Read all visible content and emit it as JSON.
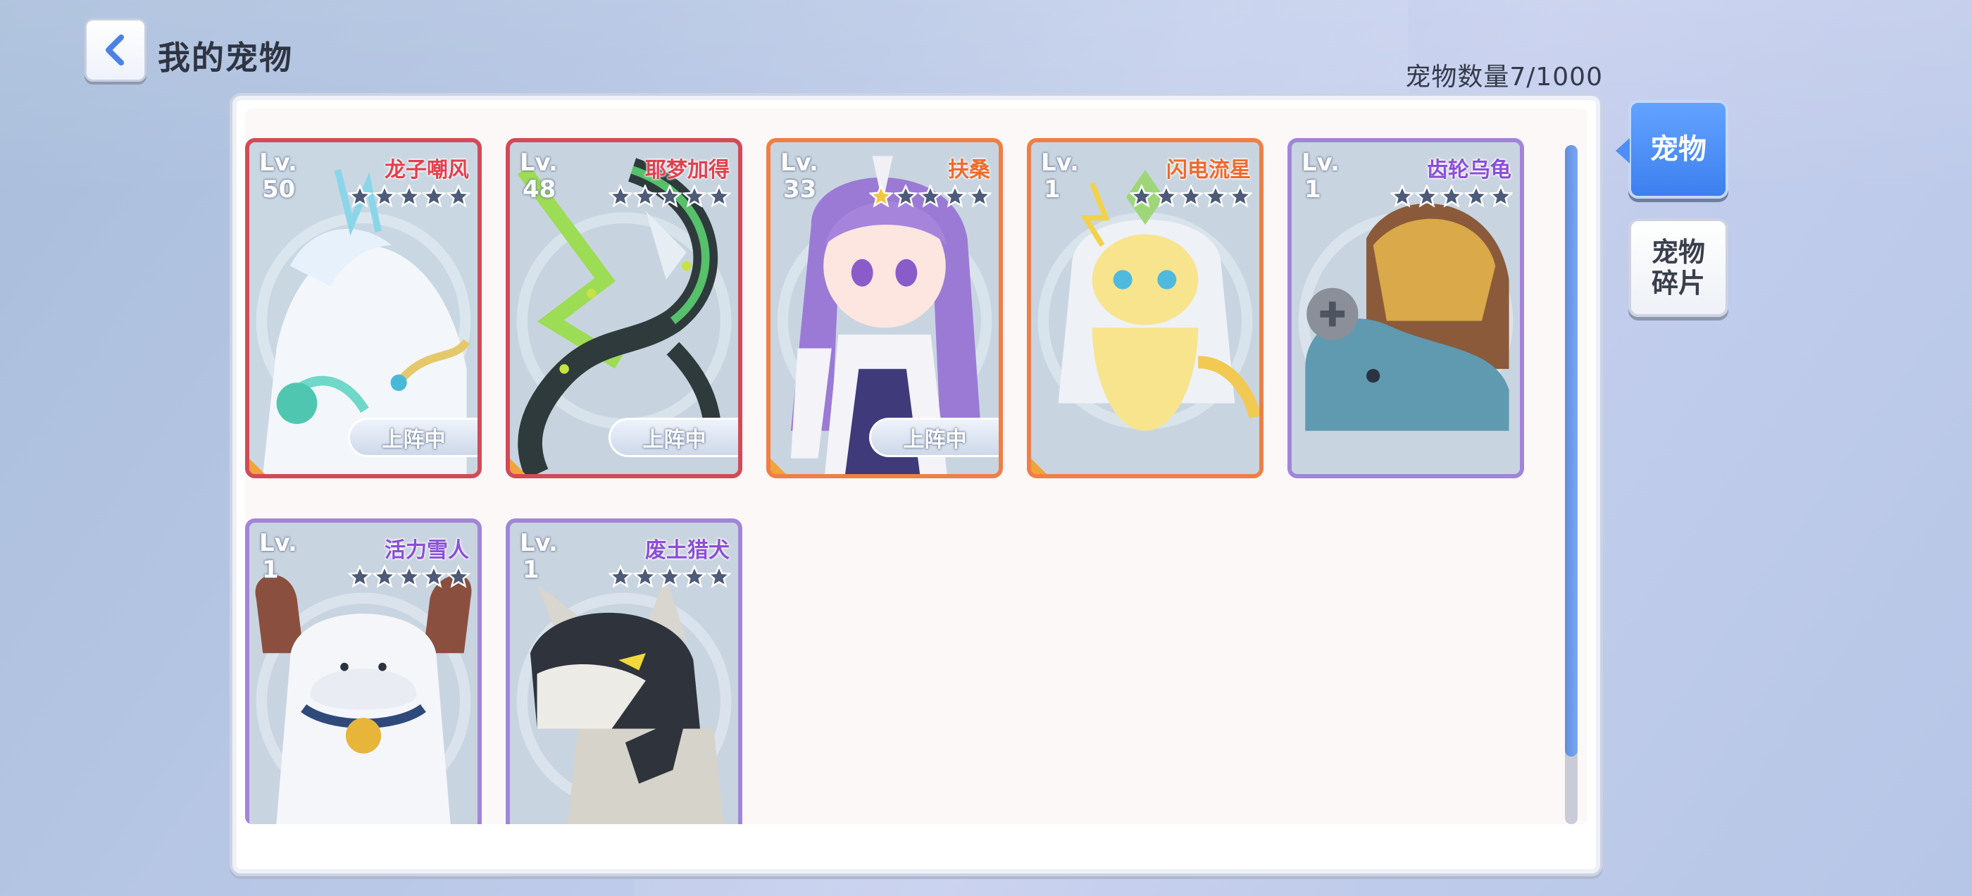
{
  "header": {
    "title": "我的宠物",
    "pet_count": "宠物数量7/1000"
  },
  "tabs": [
    {
      "label": "宠物",
      "active": true
    },
    {
      "label": "宠物碎片",
      "active": false
    }
  ],
  "colors": {
    "rarity_red": "#d34a57",
    "rarity_orange": "#ef7f45",
    "rarity_purple": "#a185d8",
    "accent_blue": "#4d8ff6"
  },
  "pets": [
    {
      "name": "龙子嘲风",
      "lv_label": "Lv.",
      "level": "50",
      "stars": 0,
      "badge": "上阵中",
      "rarity": "red",
      "art": "white-dragon"
    },
    {
      "name": "耶梦加得",
      "lv_label": "Lv.",
      "level": "48",
      "stars": 0,
      "badge": "上阵中",
      "rarity": "red",
      "art": "green-serpent"
    },
    {
      "name": "扶桑",
      "lv_label": "Lv.",
      "level": "33",
      "stars": 1,
      "badge": "上阵中",
      "rarity": "orange",
      "art": "purple-hair-girl"
    },
    {
      "name": "闪电流星",
      "lv_label": "Lv.",
      "level": "1",
      "stars": 0,
      "badge": "",
      "rarity": "orange",
      "art": "yellow-electric-creature"
    },
    {
      "name": "齿轮乌龟",
      "lv_label": "Lv.",
      "level": "1",
      "stars": 0,
      "badge": "",
      "rarity": "purple",
      "art": "gear-turtle"
    },
    {
      "name": "活力雪人",
      "lv_label": "Lv.",
      "level": "1",
      "stars": 0,
      "badge": "",
      "rarity": "purple",
      "art": "snow-yeti"
    },
    {
      "name": "废土猎犬",
      "lv_label": "Lv.",
      "level": "1",
      "stars": 0,
      "badge": "",
      "rarity": "purple",
      "art": "wasteland-hound"
    }
  ],
  "star_max": 5
}
